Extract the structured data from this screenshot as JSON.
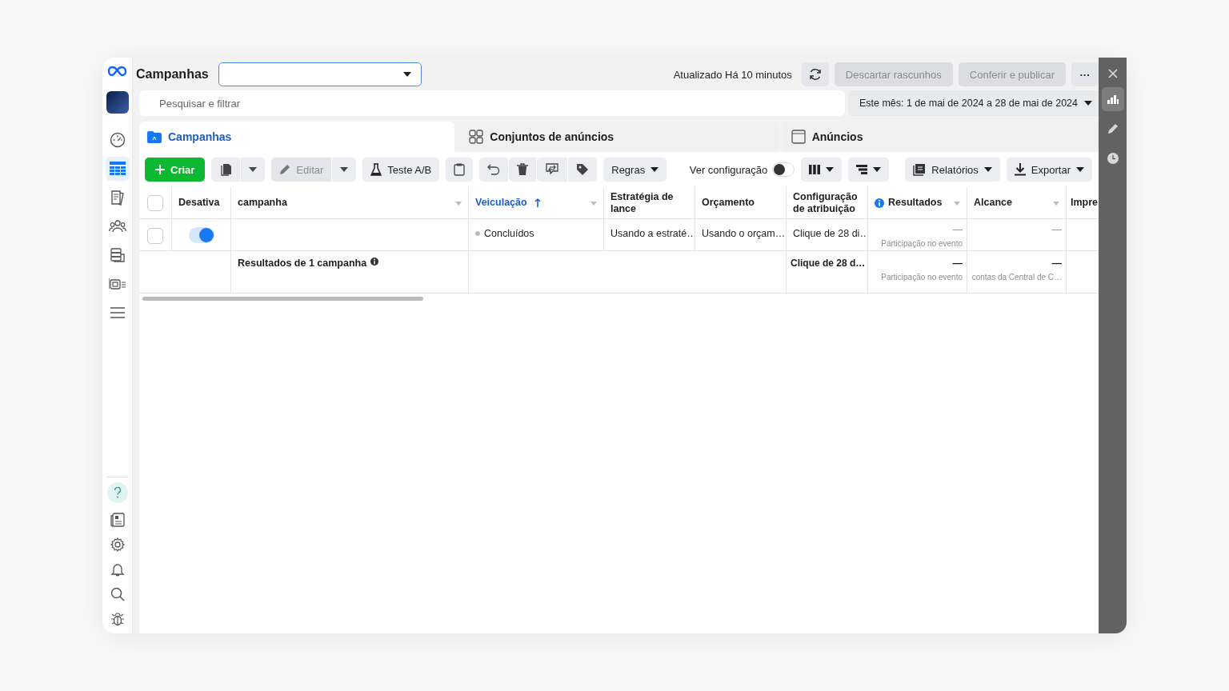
{
  "header": {
    "title": "Campanhas",
    "updated": "Atualizado Há 10 minutos",
    "buttons": [
      {
        "label": "Descartar rascunhos",
        "disabled": true
      },
      {
        "label": "Conferir e publicar",
        "disabled": true
      }
    ],
    "more": "···"
  },
  "filter": {
    "placeholder": "Pesquisar e filtrar",
    "date_range": "Este mês: 1 de mai de 2024 a 28 de mai de 2024"
  },
  "tabs": [
    {
      "label": "Campanhas",
      "selected": true
    },
    {
      "label": "Conjuntos de anúncios",
      "selected": false
    },
    {
      "label": "Anúncios",
      "selected": false
    }
  ],
  "toolbar": {
    "create": "Criar",
    "edit": {
      "label": "Editar",
      "disabled": true
    },
    "ab_test": "Teste A/B",
    "rules": "Regras",
    "view_config": {
      "label": "Ver configuração",
      "on": false
    },
    "reports": "Relatórios",
    "export": "Exportar"
  },
  "table": {
    "all_checked": false,
    "columns": [
      {
        "label": "Desativa",
        "sorted": false,
        "info": false,
        "has_menu": false
      },
      {
        "label": "campanha",
        "sorted": false,
        "info": false,
        "has_menu": true
      },
      {
        "label": "Veiculação",
        "sorted": true,
        "info": false,
        "has_menu": true
      },
      {
        "label": "Estratégia de lance",
        "sorted": false,
        "info": false,
        "has_menu": false
      },
      {
        "label": "Orçamento",
        "sorted": false,
        "info": false,
        "has_menu": false
      },
      {
        "label": "Configuração de atribuição",
        "sorted": false,
        "info": false,
        "has_menu": false
      },
      {
        "label": "Resultados",
        "sorted": false,
        "info": true,
        "has_menu": true
      },
      {
        "label": "Alcance",
        "sorted": false,
        "info": false,
        "has_menu": true
      },
      {
        "label": "Impre",
        "sorted": false,
        "info": false
      }
    ],
    "rows": [
      {
        "checked": false,
        "on": true,
        "delivery": "Concluídos",
        "bid_strategy": "Usando a estraté…",
        "budget": "Usando o orçam…",
        "attribution": "Clique de 28 di…",
        "results": "—",
        "results_note": "Participação no evento",
        "reach": "—"
      }
    ],
    "summary": {
      "label": "Resultados de 1 campanha",
      "attribution": "Clique de 28 d…",
      "results": "—",
      "results_note": "Participação no evento",
      "reach": "—",
      "reach_note": "contas da Central de C…"
    }
  },
  "sidebar": {
    "items": [
      {
        "selected": false
      },
      {
        "selected": true
      },
      {
        "selected": false
      },
      {
        "selected": false
      },
      {
        "selected": false
      },
      {
        "selected": false
      },
      {
        "selected": false
      }
    ]
  },
  "rail": {
    "items": [
      {
        "selected": true
      },
      {
        "selected": false
      },
      {
        "selected": false
      }
    ]
  }
}
